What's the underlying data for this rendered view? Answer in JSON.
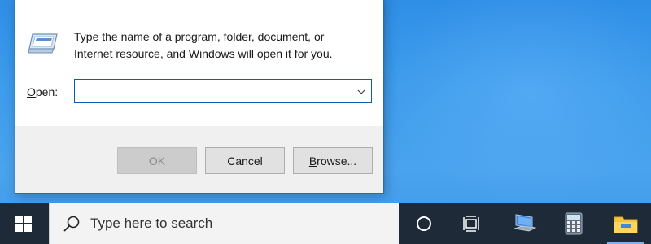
{
  "dialog": {
    "description_line1": "Type the name of a program, folder, document, or",
    "description_line2": "Internet resource, and Windows will open it for you.",
    "open_label_accel": "O",
    "open_label_rest": "pen:",
    "open_value": "",
    "buttons": {
      "ok": "OK",
      "cancel": "Cancel",
      "browse_accel": "B",
      "browse_rest": "rowse..."
    }
  },
  "taskbar": {
    "search_placeholder": "Type here to search",
    "icons": [
      "windows-logo-icon",
      "search-icon",
      "cortana-icon",
      "task-view-icon",
      "network-computer-icon",
      "calculator-icon",
      "file-explorer-icon"
    ]
  },
  "colors": {
    "desktop": "#3d9cec",
    "taskbar": "#1f2a38",
    "dialog_border": "#2b6cb0",
    "field_border": "#0b5ea8"
  }
}
